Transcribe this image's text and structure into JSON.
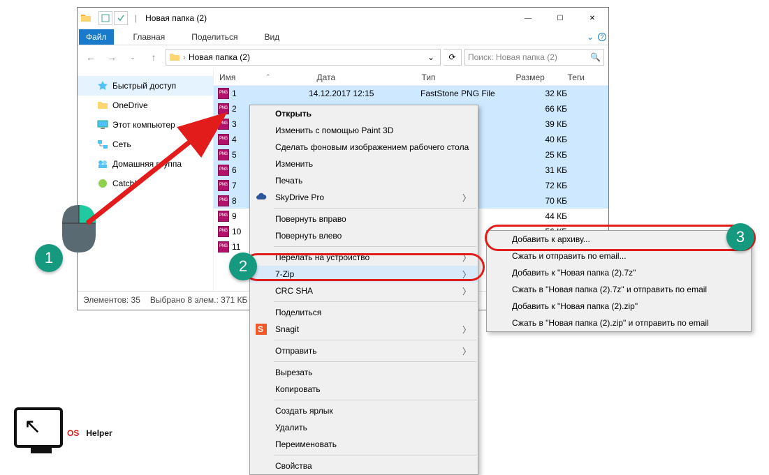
{
  "window": {
    "title": "Новая папка (2)",
    "tabs": {
      "file": "Файл",
      "home": "Главная",
      "share": "Поделиться",
      "view": "Вид"
    },
    "address": {
      "root": "",
      "folder": "Новая папка (2)"
    },
    "search_placeholder": "Поиск: Новая папка (2)",
    "columns": {
      "name": "Имя",
      "date": "Дата",
      "type": "Тип",
      "size": "Размер",
      "tags": "Теги"
    },
    "status": {
      "items": "Элементов: 35",
      "selected": "Выбрано 8 элем.: 371 КБ"
    }
  },
  "sidebar": [
    {
      "label": "Быстрый доступ",
      "icon": "star"
    },
    {
      "label": "OneDrive",
      "icon": "folder"
    },
    {
      "label": "Этот компьютер",
      "icon": "pc"
    },
    {
      "label": "Сеть",
      "icon": "net"
    },
    {
      "label": "Домашняя группа",
      "icon": "home"
    },
    {
      "label": "Catch!",
      "icon": "catch"
    }
  ],
  "files": [
    {
      "name": "1",
      "date": "14.12.2017 12:15",
      "type": "FastStone PNG File",
      "size": "32 КБ",
      "sel": true
    },
    {
      "name": "2",
      "date": "",
      "type": "",
      "size": "66 КБ",
      "sel": true
    },
    {
      "name": "3",
      "date": "",
      "type": "",
      "size": "39 КБ",
      "sel": true
    },
    {
      "name": "4",
      "date": "",
      "type": "",
      "size": "40 КБ",
      "sel": true
    },
    {
      "name": "5",
      "date": "",
      "type": "",
      "size": "25 КБ",
      "sel": true
    },
    {
      "name": "6",
      "date": "",
      "type": "",
      "size": "31 КБ",
      "sel": true
    },
    {
      "name": "7",
      "date": "",
      "type": "",
      "size": "72 КБ",
      "sel": true
    },
    {
      "name": "8",
      "date": "",
      "type": "",
      "size": "70 КБ",
      "sel": true
    },
    {
      "name": "9",
      "date": "",
      "type": "",
      "size": "44 КБ",
      "sel": false
    },
    {
      "name": "10",
      "date": "",
      "type": "",
      "size": "56 КБ",
      "sel": false
    },
    {
      "name": "11",
      "date": "",
      "type": "",
      "size": "",
      "sel": false
    }
  ],
  "context1": [
    {
      "t": "Открыть",
      "sep": false,
      "bold": true
    },
    {
      "t": "Изменить с помощью Paint 3D",
      "sep": false
    },
    {
      "t": "Сделать фоновым изображением рабочего стола",
      "sep": false
    },
    {
      "t": "Изменить",
      "sep": false
    },
    {
      "t": "Печать",
      "sep": false
    },
    {
      "t": "SkyDrive Pro",
      "sep": false,
      "icon": "cloud",
      "sub": true
    },
    {
      "sep": true
    },
    {
      "t": "Повернуть вправо",
      "sep": false
    },
    {
      "t": "Повернуть влево",
      "sep": false
    },
    {
      "sep": true
    },
    {
      "t": "Перелать на устройство",
      "sep": false,
      "sub": true
    },
    {
      "t": "7-Zip",
      "sep": false,
      "sub": true,
      "hl": true
    },
    {
      "t": "CRC SHA",
      "sep": false,
      "sub": true
    },
    {
      "sep": true
    },
    {
      "t": "Поделиться",
      "sep": false
    },
    {
      "t": "Snagit",
      "sep": false,
      "icon": "snagit",
      "sub": true
    },
    {
      "sep": true
    },
    {
      "t": "Отправить",
      "sep": false,
      "sub": true
    },
    {
      "sep": true
    },
    {
      "t": "Вырезать",
      "sep": false
    },
    {
      "t": "Копировать",
      "sep": false
    },
    {
      "sep": true
    },
    {
      "t": "Создать ярлык",
      "sep": false
    },
    {
      "t": "Удалить",
      "sep": false
    },
    {
      "t": "Переименовать",
      "sep": false
    },
    {
      "sep": true
    },
    {
      "t": "Свойства",
      "sep": false
    }
  ],
  "context2": [
    {
      "t": "Добавить к архиву..."
    },
    {
      "t": "Сжать и отправить по email..."
    },
    {
      "t": "Добавить к \"Новая папка (2).7z\""
    },
    {
      "t": "Сжать в \"Новая папка (2).7z\" и отправить по email"
    },
    {
      "t": "Добавить к \"Новая папка (2).zip\""
    },
    {
      "t": "Сжать в \"Новая папка (2).zip\" и отправить по email"
    }
  ],
  "markers": {
    "m1": "1",
    "m2": "2",
    "m3": "3"
  },
  "logo": {
    "os": "OS",
    "helper": "Helper"
  }
}
